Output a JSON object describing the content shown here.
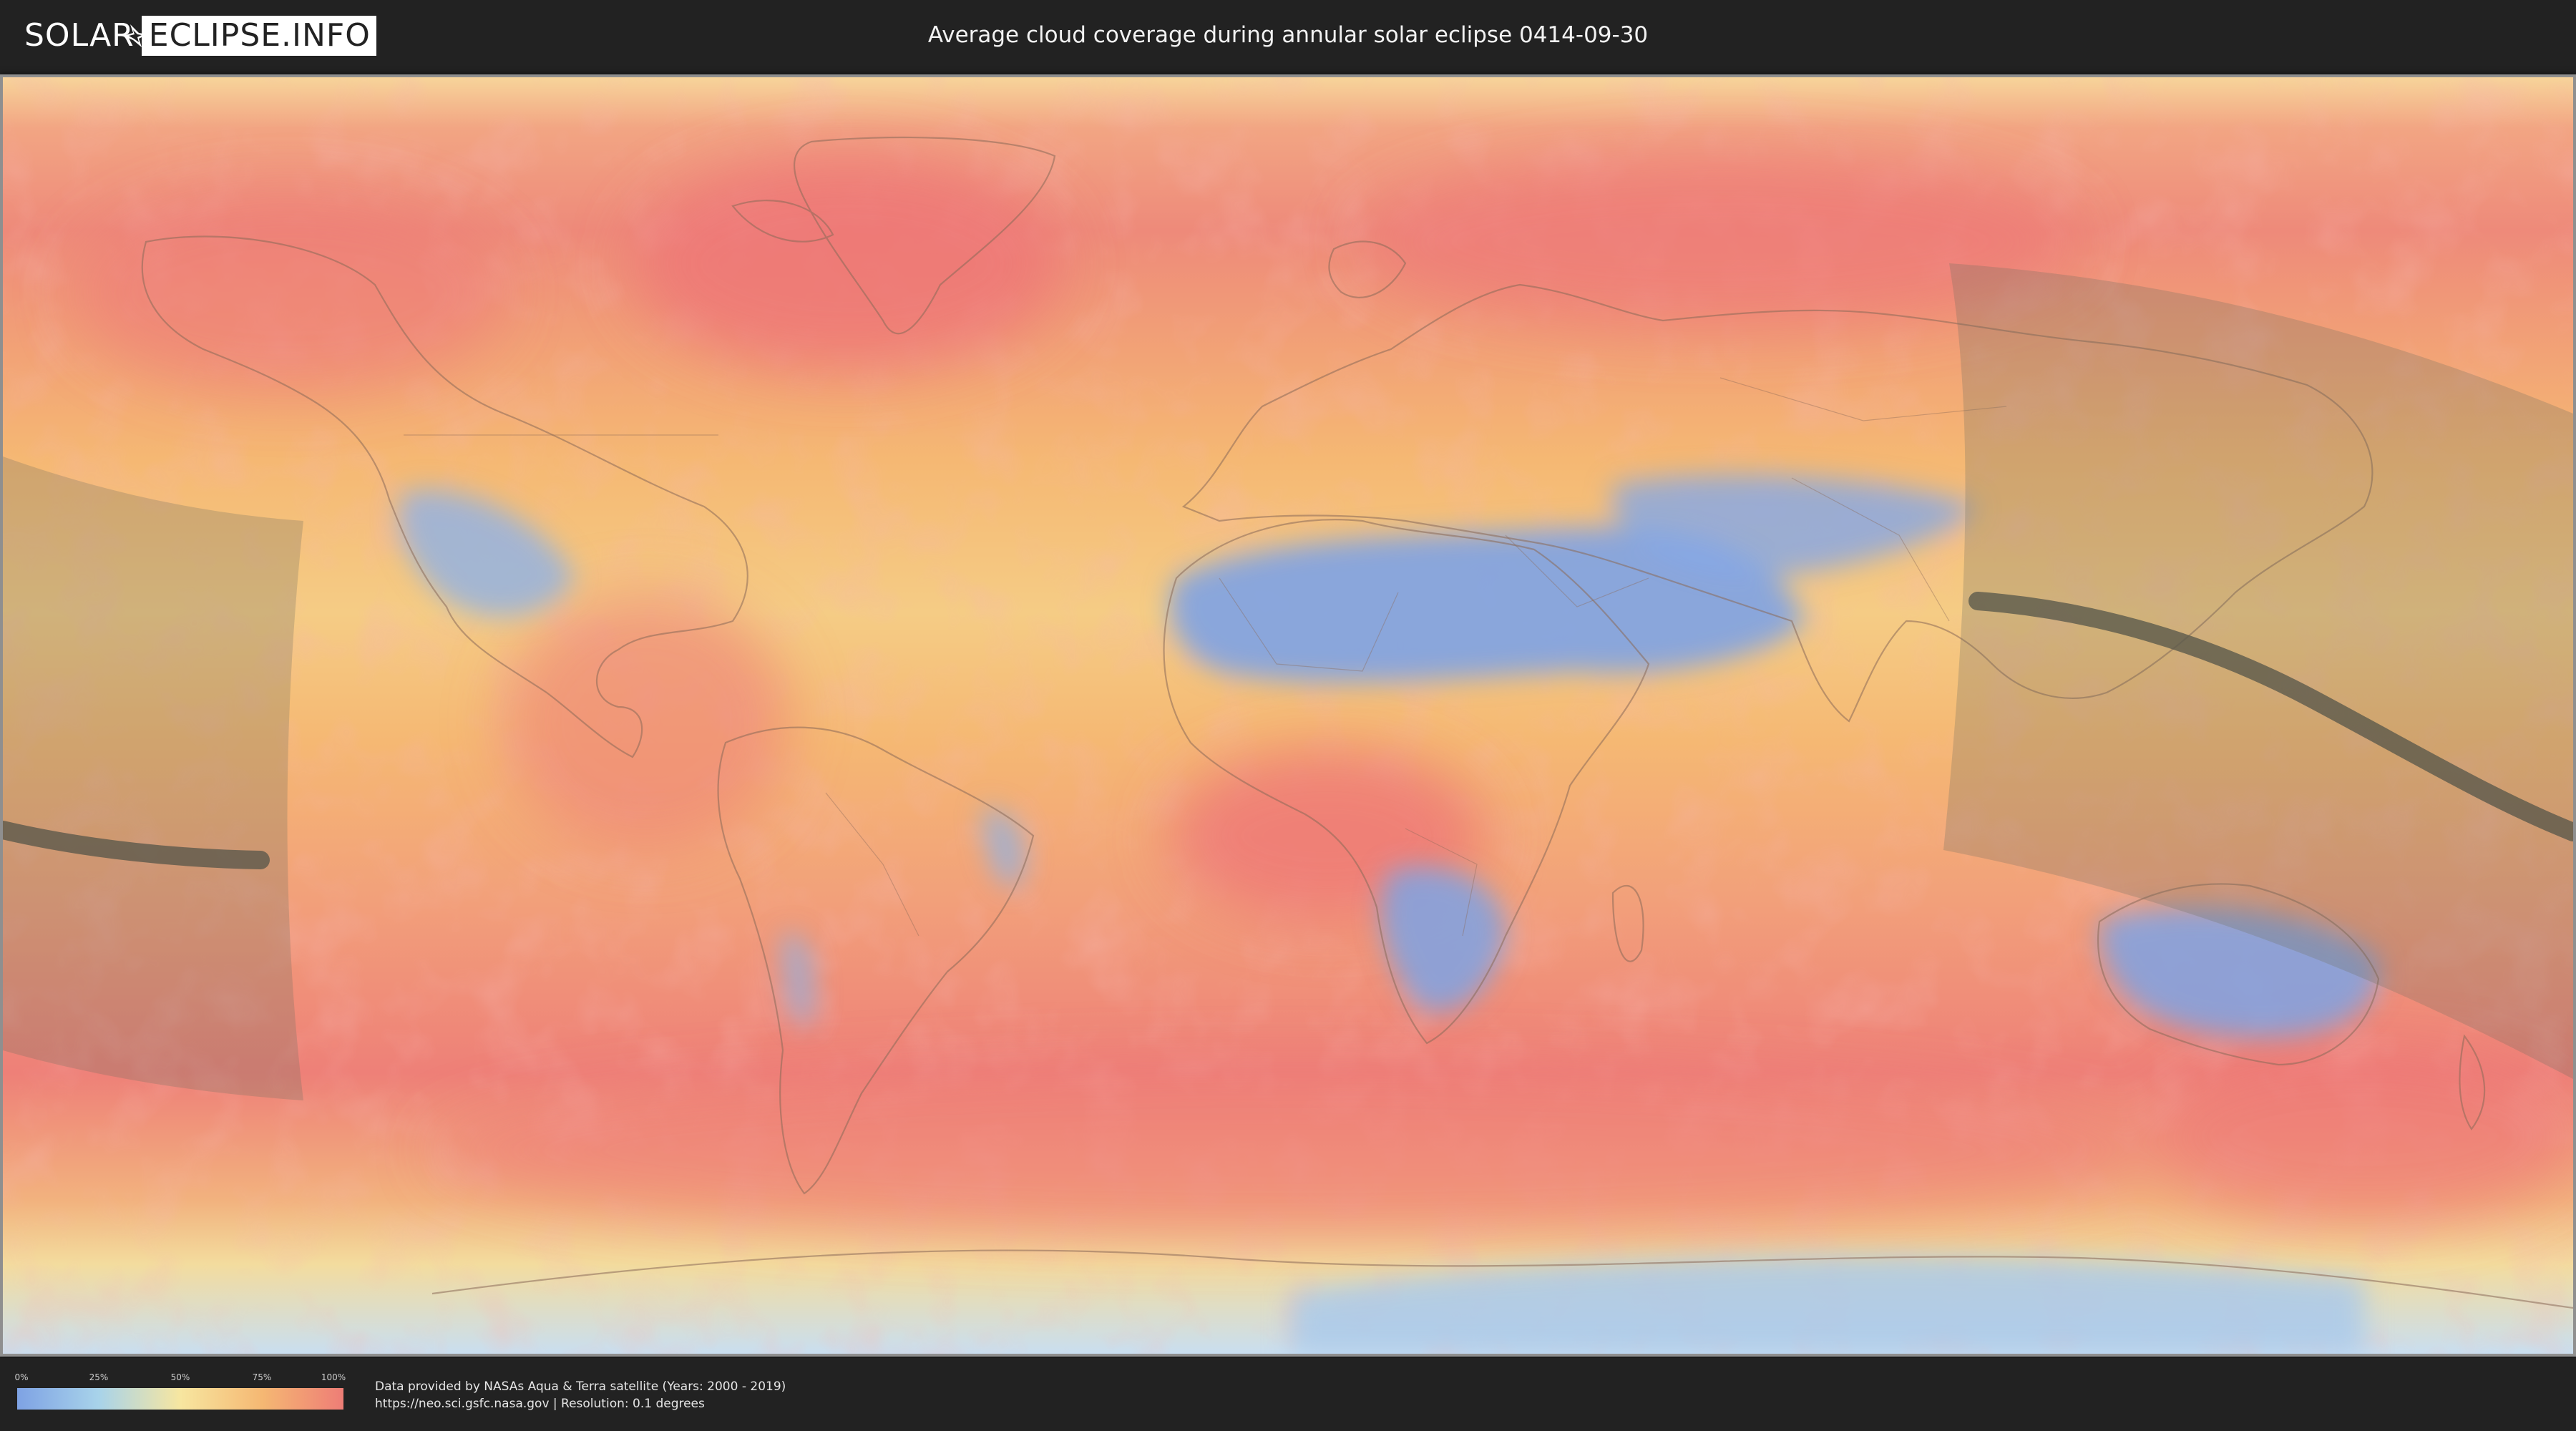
{
  "header": {
    "logo_left": "SOLAR",
    "logo_right": "ECLIPSE.INFO",
    "title": "Average cloud coverage during annular solar eclipse 0414-09-30"
  },
  "legend": {
    "ticks": [
      "0%",
      "25%",
      "50%",
      "75%",
      "100%"
    ],
    "colors": [
      "#7ea2e4",
      "#a8d3ea",
      "#f7e6a0",
      "#f5b873",
      "#ee7d76"
    ]
  },
  "footer": {
    "credit_line1": "Data provided by NASAs Aqua & Terra satellite (Years: 2000 - 2019)",
    "credit_line2": "https://neo.sci.gsfc.nasa.gov | Resolution: 0.1 degrees"
  },
  "map": {
    "colors": {
      "cloudy": "#ee7d76",
      "mid_high": "#f5b873",
      "mid": "#f7e6a0",
      "low": "#a8d3ea",
      "clear": "#7ea2e4",
      "eclipse_shade": "#6f7060",
      "eclipse_path": "#55554a",
      "coastline": "#8a6a58"
    }
  }
}
